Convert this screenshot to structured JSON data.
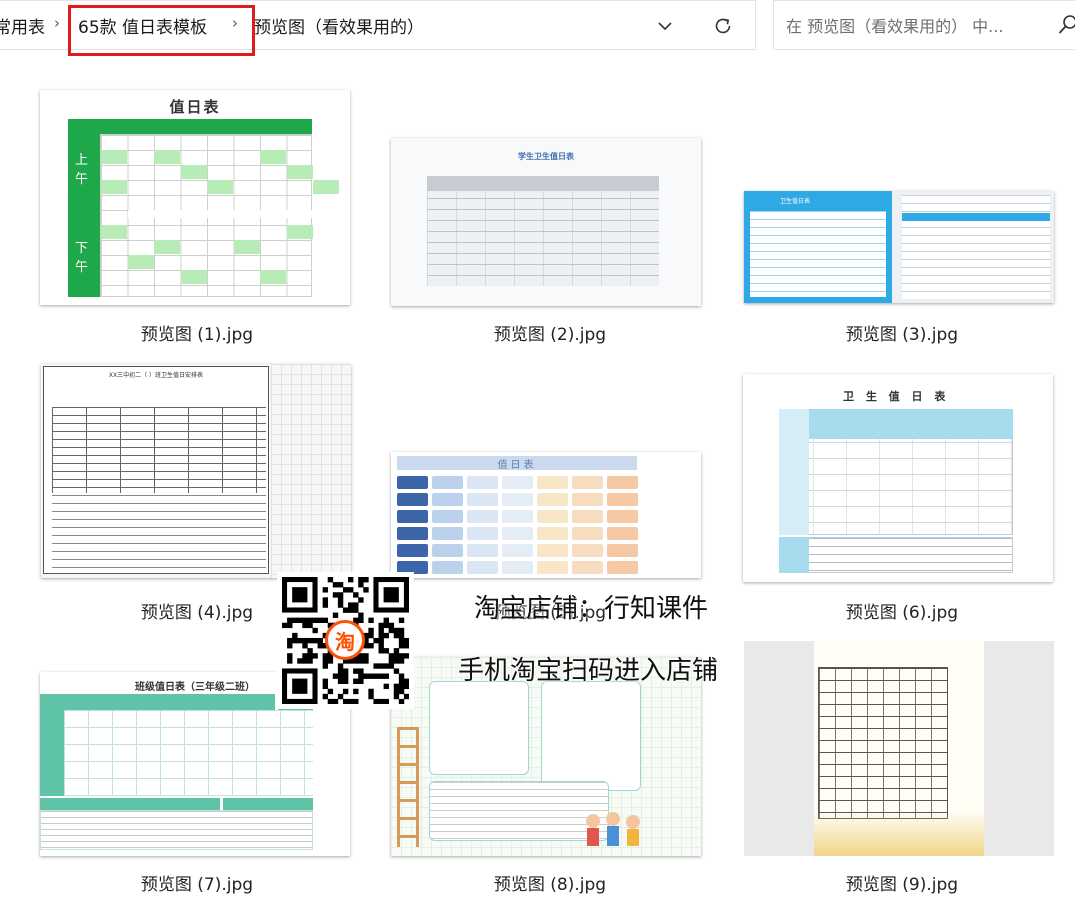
{
  "breadcrumb": {
    "items": [
      "常用表",
      "65款 值日表模板",
      "预览图（看效果用的）"
    ],
    "separator": "›",
    "highlight_color": "#e01b1b"
  },
  "address_bar": {
    "dropdown_icon": "chevron-down-icon",
    "refresh_icon": "refresh-icon"
  },
  "search": {
    "placeholder": "在 预览图（看效果用的） 中...",
    "icon": "search-icon"
  },
  "files": [
    {
      "name": "预览图 (1).jpg",
      "thumb_title": "值日表",
      "thumb_cells": [
        "上午",
        "下午"
      ]
    },
    {
      "name": "预览图 (2).jpg",
      "thumb_title": "学生卫生值日表"
    },
    {
      "name": "预览图 (3).jpg",
      "thumb_title": "卫生值日表"
    },
    {
      "name": "预览图 (4).jpg",
      "thumb_title": "XX三中初二（ ）班卫生值日安排表"
    },
    {
      "name": "预览图 (5).jpg",
      "thumb_title": "值日表"
    },
    {
      "name": "预览图 (6).jpg",
      "thumb_title": "卫 生 值 日 表"
    },
    {
      "name": "预览图 (7).jpg",
      "thumb_title": "班级值日表（三年级二班）"
    },
    {
      "name": "预览图 (8).jpg"
    },
    {
      "name": "预览图 (9).jpg"
    }
  ],
  "watermark": {
    "line1": "淘宝店铺：行知课件",
    "line2": "手机淘宝扫码进入店铺",
    "qr_badge": "淘",
    "badge_color": "#ff5000"
  }
}
